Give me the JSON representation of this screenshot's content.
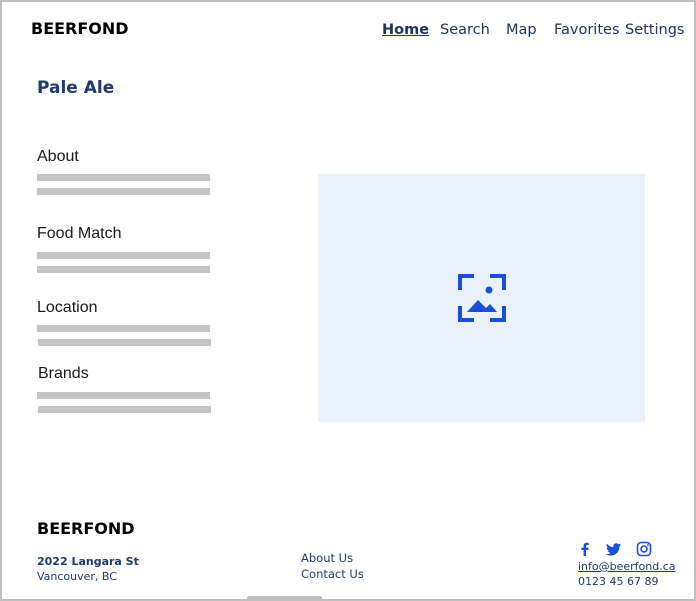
{
  "header": {
    "logo": "BEERFOND",
    "nav": [
      "Home",
      "Search",
      "Map",
      "Favorites",
      "Settings"
    ],
    "active": "Home"
  },
  "page": {
    "title": "Pale Ale",
    "sections": [
      "About",
      "Food Match",
      "Location",
      "Brands"
    ],
    "image_icon": "image-placeholder-icon"
  },
  "footer": {
    "logo": "BEERFOND",
    "address_line1": "2022 Langara St",
    "address_line2": "Vancouver, BC",
    "links": [
      "About Us",
      "Contact Us"
    ],
    "social": [
      "facebook-icon",
      "twitter-icon",
      "instagram-icon"
    ],
    "email": "info@beerfond.ca",
    "phone": "0123 45 67 89"
  },
  "colors": {
    "accent": "#1f3a6e",
    "icon_blue": "#1d4ed8",
    "image_bg": "#e9f1fd",
    "placeholder_line": "#c4c4c4"
  }
}
